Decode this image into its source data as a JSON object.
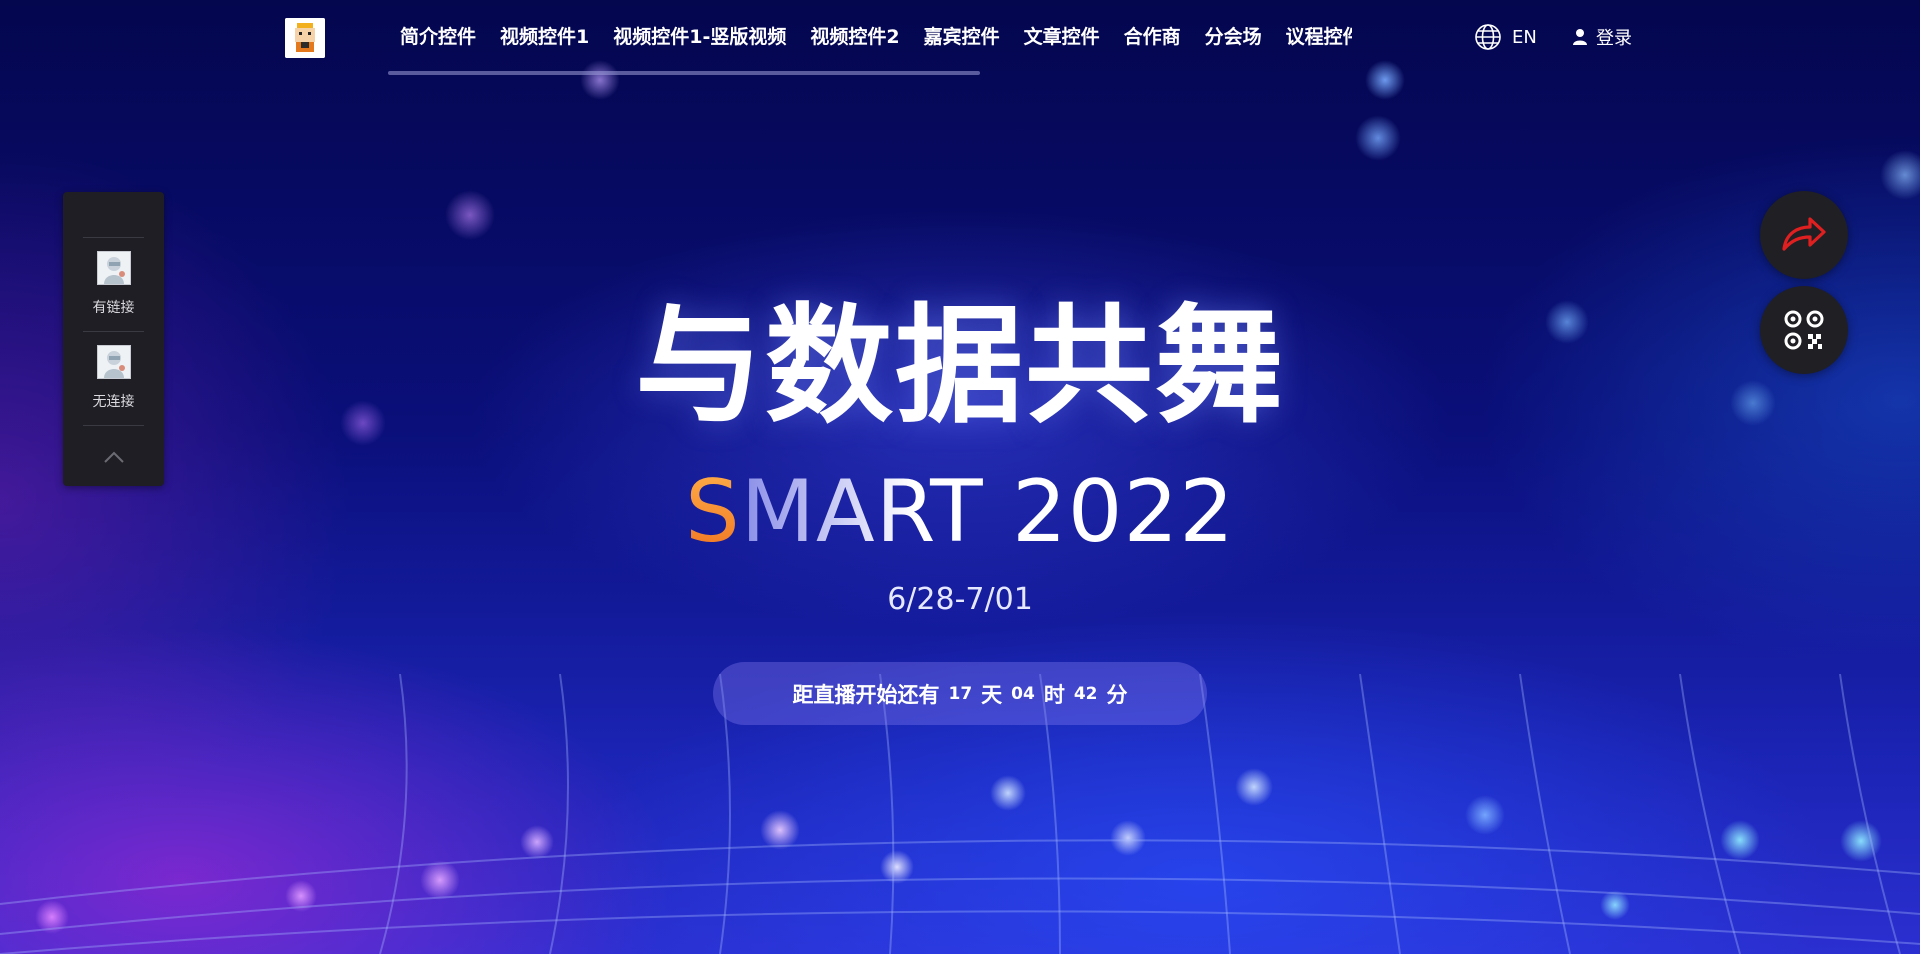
{
  "nav": {
    "items": [
      {
        "label": "简介控件"
      },
      {
        "label": "视频控件1"
      },
      {
        "label": "视频控件1-竖版视频"
      },
      {
        "label": "视频控件2"
      },
      {
        "label": "嘉宾控件"
      },
      {
        "label": "文章控件"
      },
      {
        "label": "合作商"
      },
      {
        "label": "分会场"
      },
      {
        "label": "议程控件"
      }
    ],
    "lang_label": "EN",
    "login_label": "登录"
  },
  "sidebar": {
    "items": [
      {
        "label": "有链接"
      },
      {
        "label": "无连接"
      }
    ]
  },
  "hero": {
    "title": "与数据共舞",
    "smart_first": "S",
    "smart_rest": "MART 2022",
    "dates": "6/28-7/01"
  },
  "countdown": {
    "prefix": "距直播开始还有",
    "days": "17",
    "days_unit": "天",
    "hours": "04",
    "hours_unit": "时",
    "minutes": "42",
    "minutes_unit": "分"
  },
  "colors": {
    "accent_orange": "#f28a2a",
    "share_icon_red": "#e02020",
    "panel_bg": "#1e1e24"
  },
  "icons": {
    "share": "share-arrow-icon",
    "qrcode": "qr-code-icon",
    "globe": "globe-icon",
    "user": "user-icon",
    "up": "chevron-up-icon"
  }
}
